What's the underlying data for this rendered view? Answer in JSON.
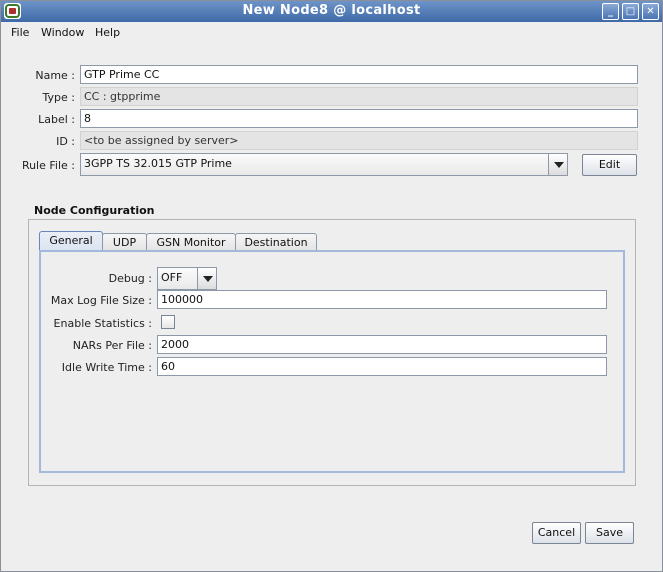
{
  "window": {
    "title": "New Node8 @ localhost",
    "buttons": {
      "minimize": "_",
      "maximize": "□",
      "close": "✕"
    }
  },
  "menu": {
    "items": [
      "File",
      "Window",
      "Help"
    ]
  },
  "form": {
    "name_label": "Name :",
    "name_value": "GTP Prime CC",
    "type_label": "Type :",
    "type_value": "CC : gtpprime",
    "label_label": "Label :",
    "label_value": "8",
    "id_label": "ID :",
    "id_value": "<to be assigned by server>",
    "rule_label": "Rule File :",
    "rule_value": "3GPP TS 32.015 GTP Prime",
    "edit_button": "Edit"
  },
  "node_config": {
    "title": "Node Configuration",
    "tabs": [
      "General",
      "UDP",
      "GSN Monitor",
      "Destination"
    ],
    "active_tab": "General",
    "general": {
      "debug_label": "Debug :",
      "debug_value": "OFF",
      "max_log_label": "Max Log File Size :",
      "max_log_value": "100000",
      "stats_label": "Enable Statistics :",
      "stats_checked": false,
      "nars_label": "NARs Per File :",
      "nars_value": "2000",
      "idle_label": "Idle Write Time :",
      "idle_value": "60"
    }
  },
  "footer": {
    "cancel": "Cancel",
    "save": "Save"
  }
}
